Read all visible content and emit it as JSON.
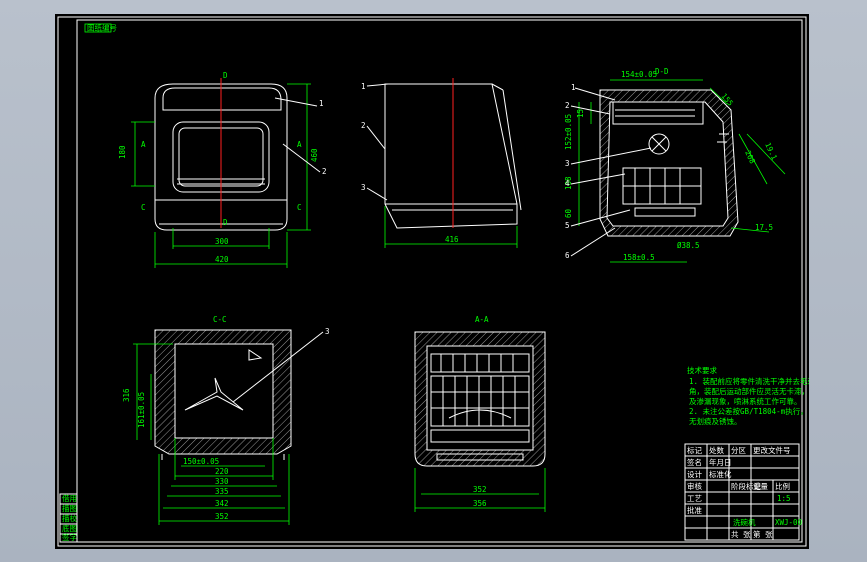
{
  "drawing": {
    "title_tag": "图纸编号",
    "section_cc": "C-C",
    "section_aa": "A-A",
    "front": {
      "dim_bottom_inner": "300",
      "dim_bottom_outer": "420",
      "dim_left": "180",
      "dim_right": "460",
      "mark_top": "D",
      "mark_bottom": "D",
      "mark_left": "C",
      "mark_right": "C",
      "mark_a": "A",
      "mark_a2": "A",
      "leader_1": "1",
      "leader_2": "2"
    },
    "side": {
      "dim_bottom": "416",
      "leader_1": "1",
      "leader_2": "2",
      "leader_3": "3"
    },
    "section_dd": {
      "mark": "D-D",
      "dim_top": "154±0.05",
      "dim_left_1": "15",
      "dim_left_2": "152±0.05",
      "dim_left_3": "188",
      "dim_left_4": "60",
      "dim_right_1": "155",
      "dim_right_2": "208",
      "dim_right_3": "19.1",
      "dim_right_4": "17.5",
      "dim_bottom_1": "Ø38.5",
      "dim_bottom_2": "158±0.5",
      "leader_1": "1",
      "leader_2": "2",
      "leader_3": "3",
      "leader_4": "4",
      "leader_5": "5",
      "leader_6": "6"
    },
    "cc": {
      "dim_left_1": "316",
      "dim_left_2": "161±0.05",
      "dim_b1": "150±0.05",
      "dim_b2": "220",
      "dim_b3": "330",
      "dim_b4": "335",
      "dim_b5": "342",
      "dim_b6": "352",
      "leader_1": "3"
    },
    "aa": {
      "dim_b1": "352",
      "dim_b2": "356"
    },
    "tech_req": {
      "heading": "技术要求",
      "lines": [
        "1. 装配前应将零件清洗干净并去毛刺,  锐边倒",
        "角，装配后运动部件应灵活无卡滞，无异常噪声",
        "及渗漏现象，喷淋系统工作可靠。",
        "2. 未注公差按GB/T1804-m执行，  零件表面应光洁",
        "无划痕及锈蚀。"
      ]
    },
    "title_block": {
      "name": "洗碗机",
      "drawing_no": "XWJ-00",
      "scale": "1:5",
      "cells": [
        "标记",
        "处数",
        "分区",
        "更改文件号",
        "签名",
        "年月日",
        "设计",
        "标准化",
        "审核",
        "工艺",
        "批准",
        "阶段标记",
        "重量",
        "比例",
        "共 张",
        "第 张"
      ]
    },
    "side_strip": {
      "cells": [
        "借用",
        "描图",
        "描校",
        "底图",
        "签字"
      ]
    }
  }
}
